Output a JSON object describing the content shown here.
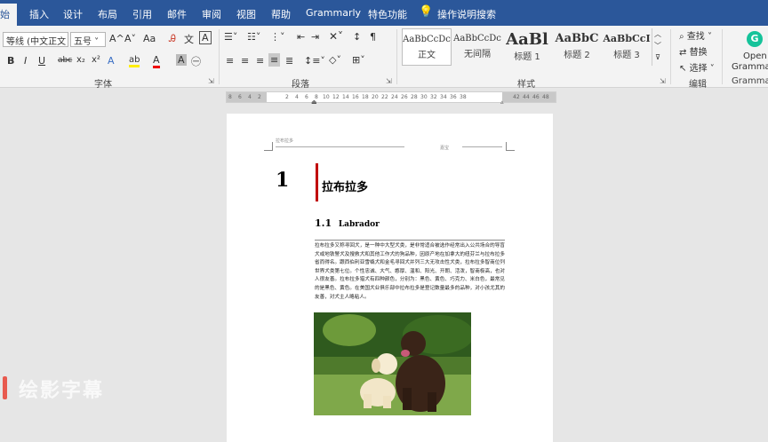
{
  "tabs": [
    "开始",
    "插入",
    "设计",
    "布局",
    "引用",
    "邮件",
    "审阅",
    "视图",
    "帮助",
    "Grammarly",
    "特色功能",
    "操作说明搜索"
  ],
  "active_tab_visible": "始",
  "font": {
    "name": "等线 (中文正文",
    "size": "五号",
    "grow": "A^",
    "shrink": "A˅",
    "case": "Aa",
    "clear": "Ꭿ",
    "pinyin": "文",
    "border": "A"
  },
  "format": {
    "bold": "B",
    "italic": "I",
    "underline": "U",
    "strike": "abc",
    "sub": "x₂",
    "sup": "x²",
    "effects": "A",
    "highlight": "ab",
    "color": "A",
    "shade": "A",
    "circle": "㊀"
  },
  "groups": {
    "font": "字体",
    "paragraph": "段落",
    "styles": "样式",
    "editing": "编辑",
    "grammarly": "Grammarly"
  },
  "styles": [
    {
      "preview": "AaBbCcDc",
      "name": "正文"
    },
    {
      "preview": "AaBbCcDc",
      "name": "无间隔"
    },
    {
      "preview": "AaBl",
      "name": "标题 1"
    },
    {
      "preview": "AaBbC",
      "name": "标题 2"
    },
    {
      "preview": "AaBbCcI",
      "name": "标题 3"
    }
  ],
  "editing": {
    "find": "查找",
    "replace": "替换",
    "select": "选择"
  },
  "grammarly": {
    "open": "Open",
    "name": "Grammarly"
  },
  "ruler": [
    "8",
    "6",
    "4",
    "2",
    "2",
    "4",
    "6",
    "8",
    "10",
    "12",
    "14",
    "16",
    "18",
    "20",
    "22",
    "24",
    "26",
    "28",
    "30",
    "32",
    "34",
    "36",
    "38",
    "42",
    "44",
    "46",
    "48"
  ],
  "page": {
    "header_left": "拉布拉多",
    "header_right": "嘉宝",
    "chapter_num": "1",
    "chapter_title": "拉布拉多",
    "section_num": "1.1",
    "section_title": "Labrador",
    "body": "拉布拉多又称寻回犬，是一种中大型犬类，是非常适合被选作经常出入公共场合的导盲犬或地铁警犬及搜救犬和其他工作犬的狗品种，因原产地在加拿大的纽芬兰与拉布拉多省而得名。跟西伯利亚雪橇犬和金毛寻回犬并列三大无攻击性犬类，拉布拉多智商位列世界犬类第七位。个性忠诚、大气、憨厚、温和、阳光、开朗、活泼，智商极高，也对人很友善。拉布拉多猎犬有四种颜色，分别为：黑色、黄色、巧克力、米白色，最常见的是黑色、黄色。在美国犬业俱乐部中拉布拉多是登记数量最多的品种，对小孩尤其的友善，对犬主人略粘人。"
  },
  "watermark": "绘影字幕",
  "colors": {
    "tabbar": "#2b579a",
    "ribbon": "#f3f3f3",
    "accent_red": "#c00000"
  }
}
